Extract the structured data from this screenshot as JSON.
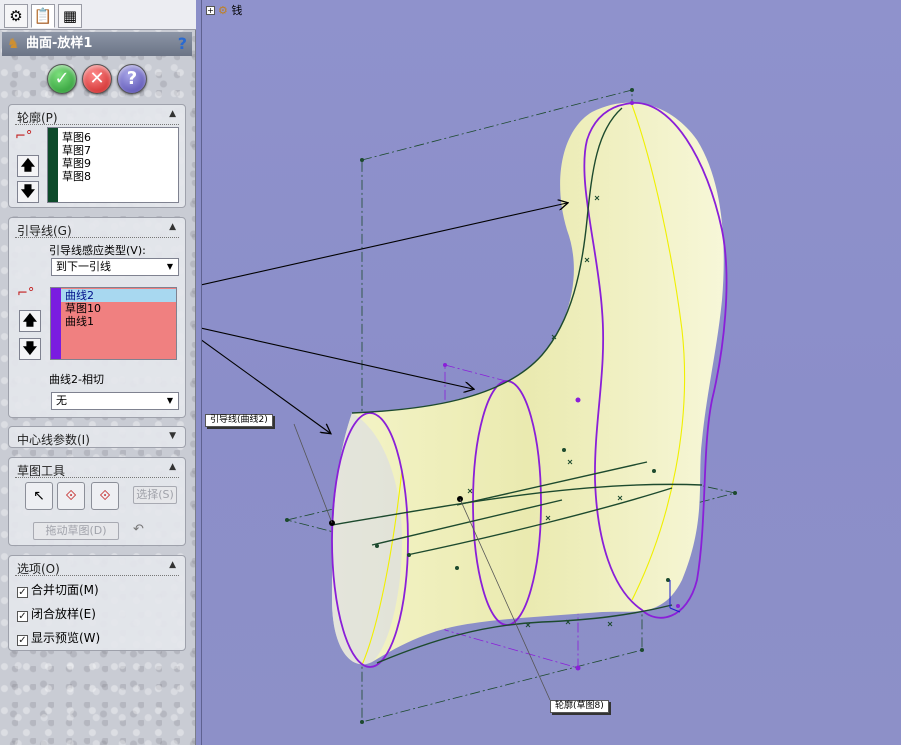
{
  "panel": {
    "tabs": [
      {
        "name": "feature-manager-tab",
        "icon": "⚙"
      },
      {
        "name": "property-manager-tab",
        "icon": "📋"
      },
      {
        "name": "config-manager-tab",
        "icon": "▦"
      }
    ],
    "title": "曲面-放样1",
    "buttons": {
      "ok": "✓",
      "cancel": "✕",
      "help": "?"
    },
    "profiles": {
      "header": "轮廓(P)",
      "items": [
        "草图6",
        "草图7",
        "草图9",
        "草图8"
      ],
      "bar_color": "#0d4a2a"
    },
    "guides": {
      "header": "引导线(G)",
      "type_label": "引导线感应类型(V):",
      "type_value": "到下一引线",
      "items": [
        "曲线2",
        "草图10",
        "曲线1"
      ],
      "bar_color": "#7a1ce0",
      "list_bg": "#f08080",
      "selected_bg": "#a8d8f0",
      "tangent_label": "曲线2-相切",
      "tangent_value": "无"
    },
    "centerline": {
      "header": "中心线参数(I)"
    },
    "sketch_tools": {
      "header": "草图工具",
      "select_label": "选择(S)",
      "drag_label": "拖动草图(D)"
    },
    "options": {
      "header": "选项(O)",
      "items": [
        {
          "label": "合并切面(M)",
          "checked": true
        },
        {
          "label": "闭合放样(E)",
          "checked": true
        },
        {
          "label": "显示预览(W)",
          "checked": true
        }
      ]
    }
  },
  "viewport": {
    "tree_label": "钱",
    "callouts": {
      "guide": "引导线(曲线2)",
      "profile": "轮廓(草图8)"
    },
    "colors": {
      "surface": "#f1f1b8",
      "profile": "#8a1fd8",
      "curve": "#1d4a2e",
      "arrow": "#000000"
    }
  }
}
